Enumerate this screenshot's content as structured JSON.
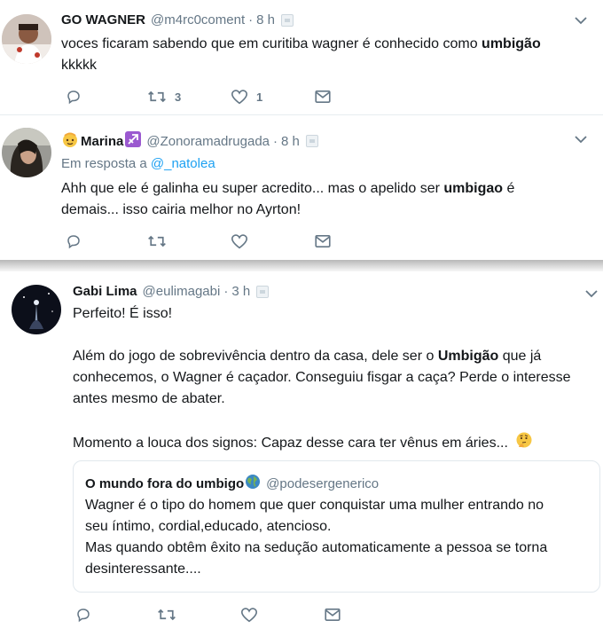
{
  "tweets": [
    {
      "name": "GO WAGNER",
      "handle": "@m4rc0coment",
      "dot": "·",
      "time": "8 h",
      "text_before": "voces ficaram sabendo que em curitiba wagner é conhecido como ",
      "text_bold": "umbigão",
      "text_after": "kkkkk",
      "retweet_count": "3",
      "like_count": "1"
    },
    {
      "name": "Marina",
      "handle": "@Zonoramadrugada",
      "dot": "·",
      "time": "8 h",
      "reply_prefix": "Em resposta a ",
      "reply_handle": "@_natolea",
      "text_before": "Ahh que ele é galinha eu super acredito... mas o apelido ser ",
      "text_bold": "umbigao",
      "text_after": " é",
      "text_line2": "demais... isso cairia melhor no Ayrton!"
    },
    {
      "name": "Gabi Lima",
      "handle": "@eulimagabi",
      "dot": "·",
      "time": "3 h",
      "p1": "Perfeito! É isso!",
      "p2_before": "Além do jogo de sobrevivência dentro da casa, dele ser o ",
      "p2_bold": "Umbigão",
      "p2_after": " que já",
      "p2_line2": "conhecemos, o Wagner é caçador. Conseguiu fisgar a caça? Perde o interesse",
      "p2_line3": "antes mesmo de abater.",
      "p3": "Momento a louca dos signos: Capaz desse cara ter vênus em áries...",
      "quote": {
        "name": "O mundo fora do umbigo",
        "handle": "@podesergenerico",
        "line1": "Wagner é o tipo do homem que quer conquistar uma mulher entrando no",
        "line2": "seu íntimo, cordial,educado, atencioso.",
        "line3": "Mas quando obtêm êxito na sedução automaticamente a pessoa se torna",
        "line4": "desinteressante...."
      }
    }
  ],
  "icons": [
    "reply-icon",
    "retweet-icon",
    "like-icon",
    "dm-icon",
    "chevron-down-icon",
    "verified-placeholder-icon",
    "globe-emoji-icon",
    "thinking-emoji-icon",
    "sagittarius-emoji-icon",
    "baby-face-emoji-icon"
  ],
  "colors": {
    "link": "#1da1f2",
    "secondary": "#657786",
    "text": "#14171a",
    "sagittarius": "#9b59d0"
  }
}
